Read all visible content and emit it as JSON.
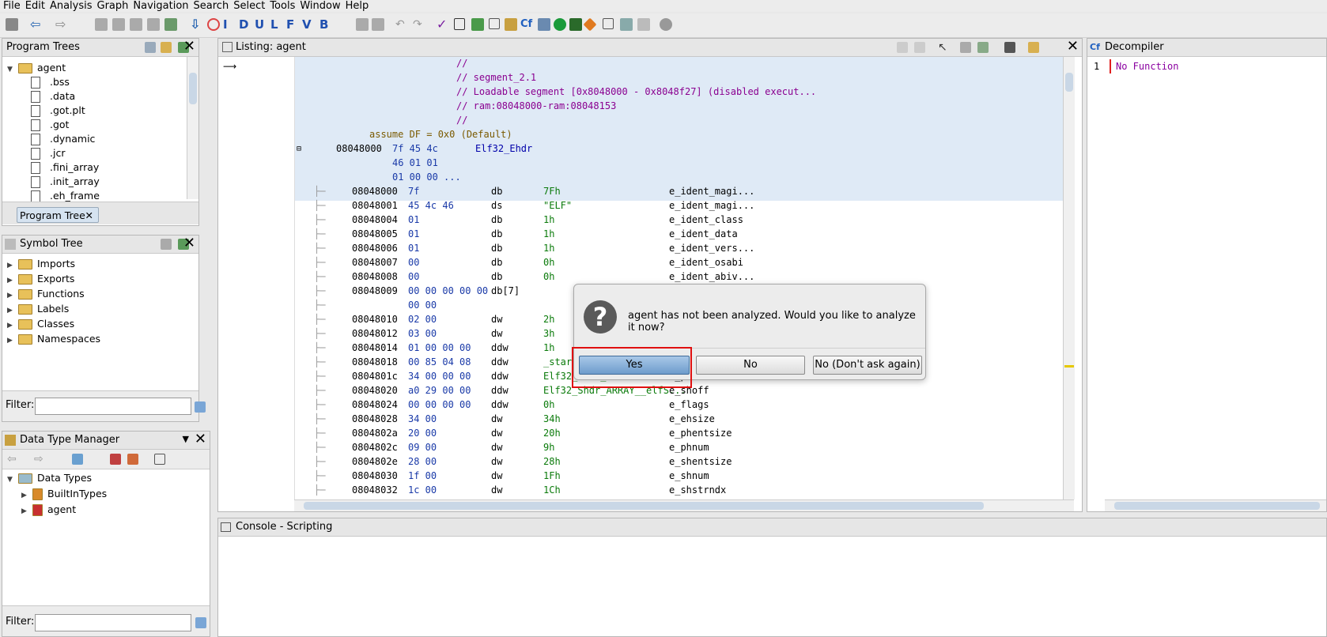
{
  "menu": [
    "File",
    "Edit",
    "Analysis",
    "Graph",
    "Navigation",
    "Search",
    "Select",
    "Tools",
    "Window",
    "Help"
  ],
  "program_trees": {
    "title": "Program Trees",
    "root": "agent",
    "items": [
      ".bss",
      ".data",
      ".got.plt",
      ".got",
      ".dynamic",
      ".jcr",
      ".fini_array",
      ".init_array",
      ".eh_frame"
    ],
    "tab_label": "Program Tree"
  },
  "symbol_tree": {
    "title": "Symbol Tree",
    "items": [
      "Imports",
      "Exports",
      "Functions",
      "Labels",
      "Classes",
      "Namespaces"
    ],
    "filter_label": "Filter:"
  },
  "data_type_manager": {
    "title": "Data Type Manager",
    "root": "Data Types",
    "items": [
      "BuiltInTypes",
      "agent"
    ],
    "filter_label": "Filter:"
  },
  "listing": {
    "title": "Listing:  agent",
    "comments": [
      "//",
      "// segment_2.1",
      "// Loadable segment  [0x8048000 - 0x8048f27] (disabled execut...",
      "// ram:08048000-ram:08048153",
      "//"
    ],
    "assume": "assume DF = 0x0  (Default)",
    "header": {
      "addr": "08048000",
      "bytes": [
        "7f 45 4c",
        "46 01 01",
        "01 00 00 ..."
      ],
      "type": "Elf32_Ehdr"
    },
    "rows": [
      {
        "addr": "08048000",
        "bytes": "7f",
        "mnem": "db",
        "oper": "7Fh",
        "field": "e_ident_magi..."
      },
      {
        "addr": "08048001",
        "bytes": "45 4c 46",
        "mnem": "ds",
        "oper": "\"ELF\"",
        "field": "e_ident_magi..."
      },
      {
        "addr": "08048004",
        "bytes": "01",
        "mnem": "db",
        "oper": "1h",
        "field": "e_ident_class"
      },
      {
        "addr": "08048005",
        "bytes": "01",
        "mnem": "db",
        "oper": "1h",
        "field": "e_ident_data"
      },
      {
        "addr": "08048006",
        "bytes": "01",
        "mnem": "db",
        "oper": "1h",
        "field": "e_ident_vers..."
      },
      {
        "addr": "08048007",
        "bytes": "00",
        "mnem": "db",
        "oper": "0h",
        "field": "e_ident_osabi"
      },
      {
        "addr": "08048008",
        "bytes": "00",
        "mnem": "db",
        "oper": "0h",
        "field": "e_ident_abiv..."
      },
      {
        "addr": "08048009",
        "bytes": "00 00 00 00 00",
        "mnem": "db[7]",
        "oper": "",
        "field": ""
      },
      {
        "addr": "",
        "bytes": "00 00",
        "mnem": "",
        "oper": "",
        "field": ""
      },
      {
        "addr": "08048010",
        "bytes": "02 00",
        "mnem": "dw",
        "oper": "2h",
        "field": ""
      },
      {
        "addr": "08048012",
        "bytes": "03 00",
        "mnem": "dw",
        "oper": "3h",
        "field": ""
      },
      {
        "addr": "08048014",
        "bytes": "01 00 00 00",
        "mnem": "ddw",
        "oper": "1h",
        "field": ""
      },
      {
        "addr": "08048018",
        "bytes": "00 85 04 08",
        "mnem": "ddw",
        "oper": "_star",
        "field": ""
      },
      {
        "addr": "0804801c",
        "bytes": "34 00 00 00",
        "mnem": "ddw",
        "oper": "Elf32_Phdr_ARRAY",
        "field": "e_phoff"
      },
      {
        "addr": "08048020",
        "bytes": "a0 29 00 00",
        "mnem": "ddw",
        "oper": "Elf32_Shdr_ARRAY__elfS...",
        "field": "e_shoff"
      },
      {
        "addr": "08048024",
        "bytes": "00 00 00 00",
        "mnem": "ddw",
        "oper": "0h",
        "field": "e_flags"
      },
      {
        "addr": "08048028",
        "bytes": "34 00",
        "mnem": "dw",
        "oper": "34h",
        "field": "e_ehsize"
      },
      {
        "addr": "0804802a",
        "bytes": "20 00",
        "mnem": "dw",
        "oper": "20h",
        "field": "e_phentsize"
      },
      {
        "addr": "0804802c",
        "bytes": "09 00",
        "mnem": "dw",
        "oper": "9h",
        "field": "e_phnum"
      },
      {
        "addr": "0804802e",
        "bytes": "28 00",
        "mnem": "dw",
        "oper": "28h",
        "field": "e_shentsize"
      },
      {
        "addr": "08048030",
        "bytes": "1f 00",
        "mnem": "dw",
        "oper": "1Fh",
        "field": "e_shnum"
      },
      {
        "addr": "08048032",
        "bytes": "1c 00",
        "mnem": "dw",
        "oper": "1Ch",
        "field": "e_shstrndx"
      }
    ]
  },
  "decompiler": {
    "title": "Decompiler",
    "line_no": "1",
    "text": "No Function"
  },
  "console": {
    "title": "Console - Scripting"
  },
  "dialog": {
    "message": "agent has not been analyzed. Would you like to analyze it now?",
    "yes": "Yes",
    "no": "No",
    "no_dont_ask": "No (Don't ask again)"
  },
  "colors": {
    "selection": "#dfeaf6",
    "dialog_highlight": "#e01010"
  }
}
